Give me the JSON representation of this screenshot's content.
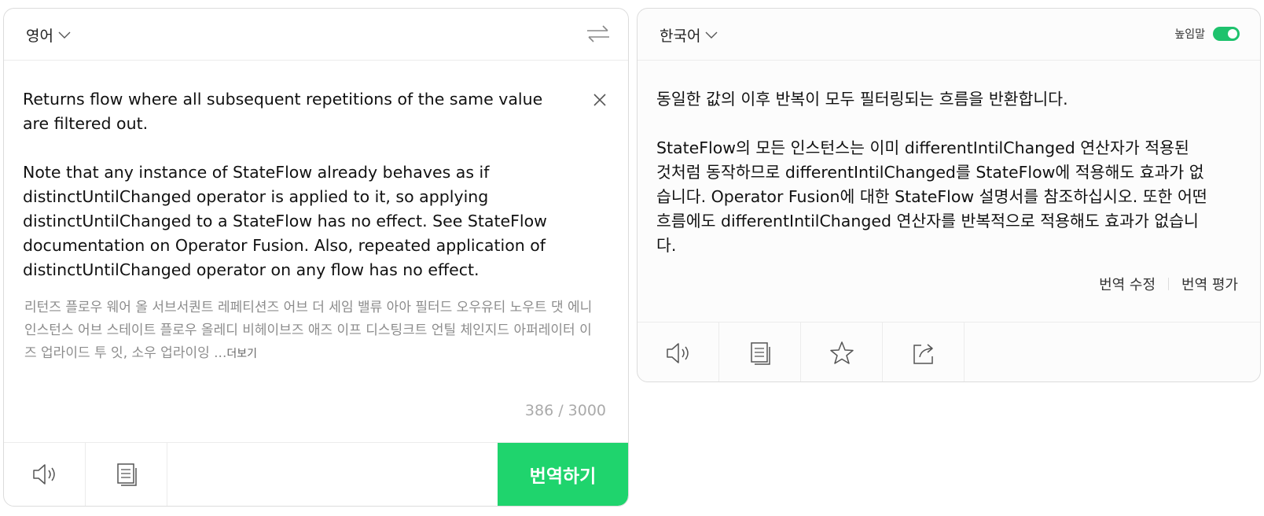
{
  "source": {
    "language": "영어",
    "text": "Returns flow where all subsequent repetitions of the same value\nare filtered out.\n\nNote that any instance of StateFlow already behaves as if\ndistinctUntilChanged operator is applied to it, so applying\ndistinctUntilChanged to a StateFlow has no effect. See StateFlow\ndocumentation on Operator Fusion. Also, repeated application of\ndistinctUntilChanged operator on any flow has no effect.",
    "pronunciation": "리턴즈 플로우 웨어 올 서브서퀀트 레페티션즈 어브 더 세임 밸류 아아 필터드 오우유티 노우트 댓 에니 인스턴스 어브 스테이트 플로우 올레디 비헤이브즈 애즈 이프 디스팅크트 언틸 체인지드 아퍼레이터 이즈 업라이드 투 잇, 소우 업라이잉 ...",
    "more_label": "더보기",
    "counter": "386 / 3000",
    "translate_label": "번역하기"
  },
  "target": {
    "language": "한국어",
    "honorific_label": "높임말",
    "honorific_on": true,
    "text": "동일한 값의 이후 반복이 모두 필터링되는 흐름을 반환합니다.\n\nStateFlow의 모든 인스턴스는 이미 differentIntilChanged 연산자가 적용된\n것처럼 동작하므로 differentIntilChanged를 StateFlow에 적용해도 효과가 없\n습니다. Operator Fusion에 대한 StateFlow 설명서를 참조하십시오. 또한 어떤\n흐름에도 differentIntilChanged 연산자를 반복적으로 적용해도 효과가 없습니\n다.",
    "edit_label": "번역 수정",
    "rate_label": "번역 평가"
  },
  "colors": {
    "accent": "#1fd46d",
    "toggle": "#1ec26d"
  },
  "icons": {
    "swap": "swap-arrows-icon",
    "clear": "close-icon",
    "speaker": "speaker-icon",
    "copy": "copy-icon",
    "star": "star-icon",
    "share": "share-icon"
  }
}
